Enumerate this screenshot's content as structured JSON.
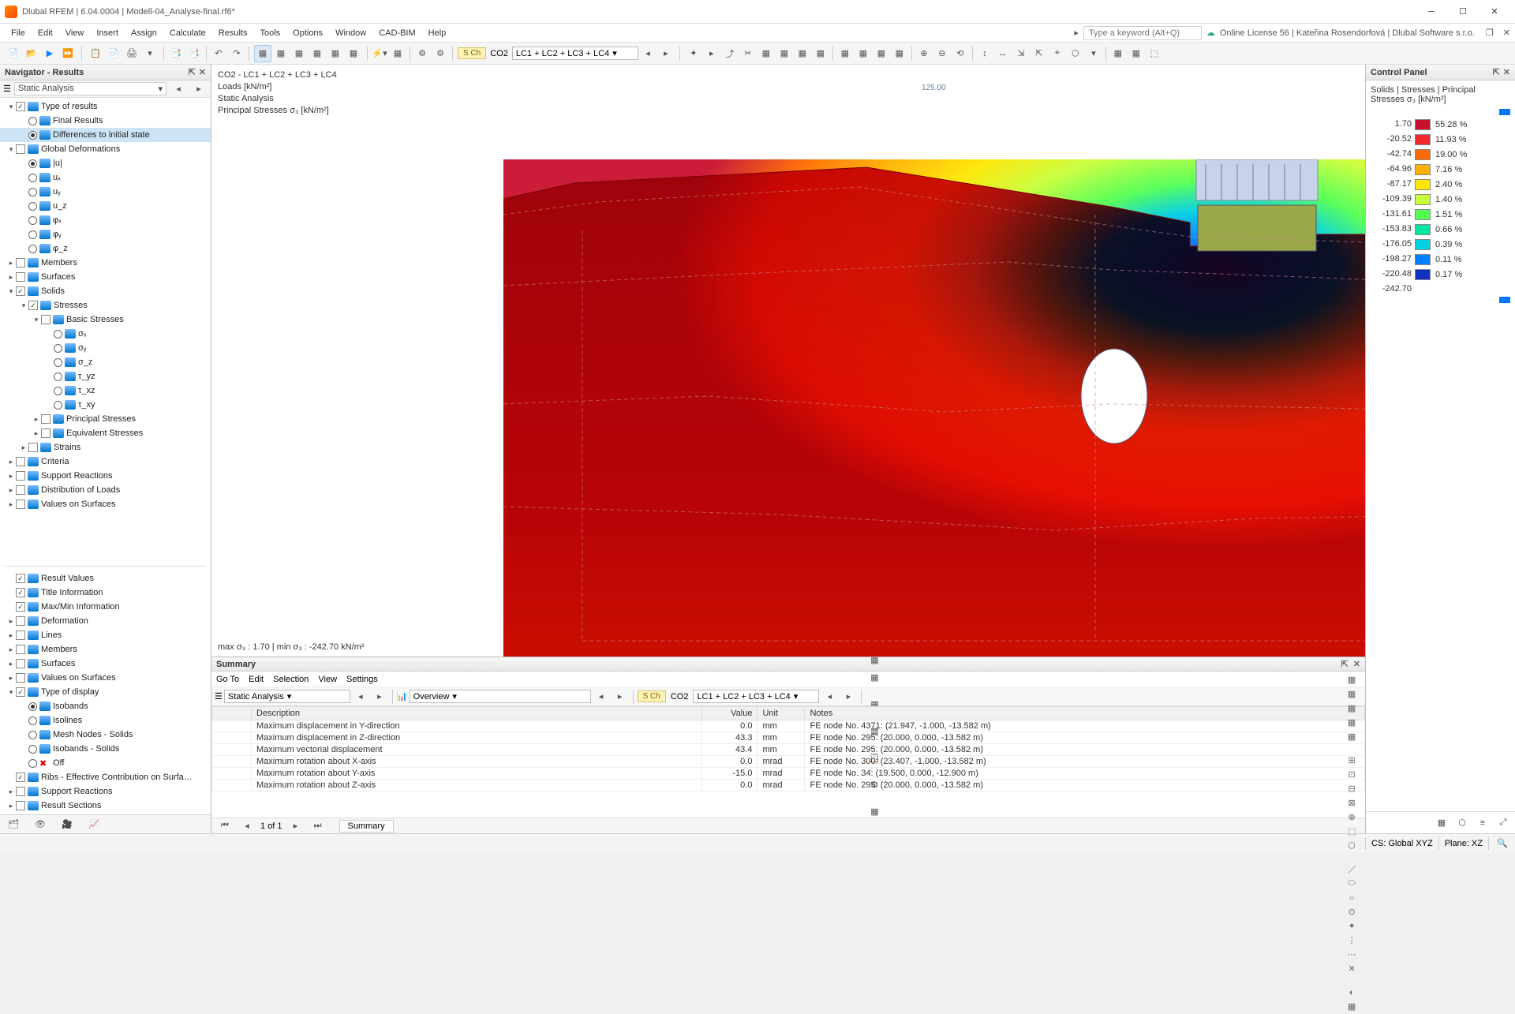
{
  "title": "Dlubal RFEM | 6.04.0004 | Modell-04_Analyse-final.rf6*",
  "menus": [
    "File",
    "Edit",
    "View",
    "Insert",
    "Assign",
    "Calculate",
    "Results",
    "Tools",
    "Options",
    "Window",
    "CAD-BIM",
    "Help"
  ],
  "search_placeholder": "Type a keyword (Alt+Q)",
  "license_text": "Online License 56 | Kateřina Rosendorfová | Dlubal Software s.r.o.",
  "tb_load_label": "S Ch",
  "tb_load_case": "CO2",
  "tb_load_combo": "LC1 + LC2 + LC3 + LC4",
  "navigator": {
    "title": "Navigator - Results",
    "filter": "Static Analysis",
    "tree": [
      {
        "d": 0,
        "t": "toggle",
        "chk": true,
        "label": "Type of results",
        "exp": "-"
      },
      {
        "d": 1,
        "t": "radio",
        "on": false,
        "label": "Final Results"
      },
      {
        "d": 1,
        "t": "radio",
        "on": true,
        "label": "Differences to initial state",
        "sel": true
      },
      {
        "d": 0,
        "t": "toggle",
        "chk": false,
        "label": "Global Deformations",
        "exp": "-"
      },
      {
        "d": 1,
        "t": "radio",
        "on": true,
        "label": "|u|"
      },
      {
        "d": 1,
        "t": "radio",
        "on": false,
        "label": "uₓ"
      },
      {
        "d": 1,
        "t": "radio",
        "on": false,
        "label": "uᵧ"
      },
      {
        "d": 1,
        "t": "radio",
        "on": false,
        "label": "u_z"
      },
      {
        "d": 1,
        "t": "radio",
        "on": false,
        "label": "φₓ"
      },
      {
        "d": 1,
        "t": "radio",
        "on": false,
        "label": "φᵧ"
      },
      {
        "d": 1,
        "t": "radio",
        "on": false,
        "label": "φ_z"
      },
      {
        "d": 0,
        "t": "toggle",
        "chk": false,
        "label": "Members",
        "exp": "+"
      },
      {
        "d": 0,
        "t": "toggle",
        "chk": false,
        "label": "Surfaces",
        "exp": "+"
      },
      {
        "d": 0,
        "t": "toggle",
        "chk": true,
        "label": "Solids",
        "exp": "-"
      },
      {
        "d": 1,
        "t": "toggle",
        "chk": true,
        "label": "Stresses",
        "exp": "-"
      },
      {
        "d": 2,
        "t": "toggle",
        "chk": false,
        "label": "Basic Stresses",
        "exp": "-"
      },
      {
        "d": 3,
        "t": "radio",
        "on": false,
        "label": "σₓ"
      },
      {
        "d": 3,
        "t": "radio",
        "on": false,
        "label": "σᵧ"
      },
      {
        "d": 3,
        "t": "radio",
        "on": false,
        "label": "σ_z"
      },
      {
        "d": 3,
        "t": "radio",
        "on": false,
        "label": "τ_yz"
      },
      {
        "d": 3,
        "t": "radio",
        "on": false,
        "label": "τ_xz"
      },
      {
        "d": 3,
        "t": "radio",
        "on": false,
        "label": "τ_xy"
      },
      {
        "d": 2,
        "t": "toggle",
        "chk": false,
        "label": "Principal Stresses",
        "exp": "+"
      },
      {
        "d": 2,
        "t": "toggle",
        "chk": false,
        "label": "Equivalent Stresses",
        "exp": "+"
      },
      {
        "d": 1,
        "t": "toggle",
        "chk": false,
        "label": "Strains",
        "exp": "+"
      },
      {
        "d": 0,
        "t": "toggle",
        "chk": false,
        "label": "Criteria",
        "exp": "+"
      },
      {
        "d": 0,
        "t": "toggle",
        "chk": false,
        "label": "Support Reactions",
        "exp": "+"
      },
      {
        "d": 0,
        "t": "toggle",
        "chk": false,
        "label": "Distribution of Loads",
        "exp": "+"
      },
      {
        "d": 0,
        "t": "toggle",
        "chk": false,
        "label": "Values on Surfaces",
        "exp": "+"
      }
    ],
    "tree2": [
      {
        "d": 0,
        "t": "check",
        "chk": true,
        "label": "Result Values"
      },
      {
        "d": 0,
        "t": "check",
        "chk": true,
        "label": "Title Information"
      },
      {
        "d": 0,
        "t": "check",
        "chk": true,
        "label": "Max/Min Information"
      },
      {
        "d": 0,
        "t": "check",
        "chk": false,
        "label": "Deformation",
        "exp": "+"
      },
      {
        "d": 0,
        "t": "check",
        "chk": false,
        "label": "Lines",
        "exp": "+"
      },
      {
        "d": 0,
        "t": "check",
        "chk": false,
        "label": "Members",
        "exp": "+"
      },
      {
        "d": 0,
        "t": "check",
        "chk": false,
        "label": "Surfaces",
        "exp": "+"
      },
      {
        "d": 0,
        "t": "check",
        "chk": false,
        "label": "Values on Surfaces",
        "exp": "+"
      },
      {
        "d": 0,
        "t": "toggle",
        "chk": true,
        "label": "Type of display",
        "exp": "-"
      },
      {
        "d": 1,
        "t": "radio",
        "on": true,
        "label": "Isobands"
      },
      {
        "d": 1,
        "t": "radio",
        "on": false,
        "label": "Isolines"
      },
      {
        "d": 1,
        "t": "radio",
        "on": false,
        "label": "Mesh Nodes - Solids"
      },
      {
        "d": 1,
        "t": "radio",
        "on": false,
        "label": "Isobands - Solids"
      },
      {
        "d": 1,
        "t": "radio",
        "on": false,
        "label": "Off",
        "red": true
      },
      {
        "d": 0,
        "t": "check",
        "chk": true,
        "label": "Ribs - Effective Contribution on Surfa…"
      },
      {
        "d": 0,
        "t": "check",
        "chk": false,
        "label": "Support Reactions",
        "exp": "+"
      },
      {
        "d": 0,
        "t": "check",
        "chk": false,
        "label": "Result Sections",
        "exp": "+"
      }
    ]
  },
  "viewport": {
    "line1": "CO2 - LC1 + LC2 + LC3 + LC4",
    "line2": "Loads [kN/m²]",
    "line3": "Static Analysis",
    "line4": "Principal Stresses σ₃ [kN/m²]",
    "load_value": "125.00",
    "footer": "max σ₃ : 1.70 | min σ₃ : -242.70 kN/m²"
  },
  "control_panel": {
    "title": "Control Panel",
    "subtitle": "Solids | Stresses | Principal Stresses σ₃ [kN/m²]",
    "scale_left": [
      "1.70",
      "-20.52",
      "-42.74",
      "-64.96",
      "-87.17",
      "-109.39",
      "-131.61",
      "-153.83",
      "-176.05",
      "-198.27",
      "-220.48",
      "-242.70"
    ],
    "scale_right": [
      "55.28 %",
      "11.93 %",
      "19.00 %",
      "7.16 %",
      "2.40 %",
      "1.40 %",
      "1.51 %",
      "0.66 %",
      "0.39 %",
      "0.11 %",
      "0.17 %"
    ],
    "colors": [
      "#c8102e",
      "#ef2b2d",
      "#ff6a00",
      "#ffb000",
      "#ffe600",
      "#c6ff3a",
      "#52ff52",
      "#00e6a0",
      "#00d0e0",
      "#0080ff",
      "#1030c0",
      "#101080"
    ]
  },
  "summary": {
    "title": "Summary",
    "menus": [
      "Go To",
      "Edit",
      "Selection",
      "View",
      "Settings"
    ],
    "combo1": "Static Analysis",
    "combo2": "Overview",
    "sch": "S Ch",
    "case": "CO2",
    "combo3": "LC1 + LC2 + LC3 + LC4",
    "headers": [
      "",
      "Description",
      "Value",
      "Unit",
      "Notes"
    ],
    "rows": [
      [
        "",
        "Maximum displacement in Y-direction",
        "0.0",
        "mm",
        "FE node No. 4371: (21.947, -1.000, -13.582 m)"
      ],
      [
        "",
        "Maximum displacement in Z-direction",
        "43.3",
        "mm",
        "FE node No. 295: (20.000, 0.000, -13.582 m)"
      ],
      [
        "",
        "Maximum vectorial displacement",
        "43.4",
        "mm",
        "FE node No. 295: (20.000, 0.000, -13.582 m)"
      ],
      [
        "",
        "Maximum rotation about X-axis",
        "0.0",
        "mrad",
        "FE node No. 300: (23.407, -1.000, -13.582 m)"
      ],
      [
        "",
        "Maximum rotation about Y-axis",
        "-15.0",
        "mrad",
        "FE node No. 34: (19.500, 0.000, -12.900 m)"
      ],
      [
        "",
        "Maximum rotation about Z-axis",
        "0.0",
        "mrad",
        "FE node No. 295: (20.000, 0.000, -13.582 m)"
      ]
    ],
    "nav_text": "1 of 1",
    "nav_tab": "Summary"
  },
  "statusbar": {
    "cs": "CS: Global XYZ",
    "plane": "Plane: XZ"
  }
}
